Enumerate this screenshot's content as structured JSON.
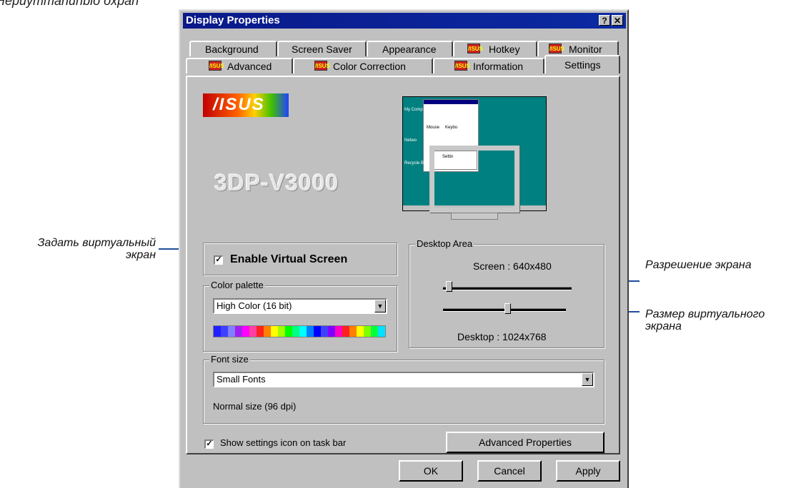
{
  "top_cutoff_text": "Hepuymmanuhbio oxpan",
  "callouts": {
    "virtual_screen": "Задать виртуальный экран",
    "resolution": "Разрешение экрана",
    "virtual_size": "Размер виртуального экрана"
  },
  "window": {
    "title": "Display Properties",
    "help_btn": "?",
    "close_btn": "✕"
  },
  "tabs_row1": [
    "Background",
    "Screen Saver",
    "Appearance",
    "Hotkey",
    "Monitor"
  ],
  "tabs_row2": [
    "Advanced",
    "Color Correction",
    "Information",
    "Settings"
  ],
  "active_tab": "Settings",
  "logo": {
    "brand": "/ISUS",
    "model": "3DP-V3000"
  },
  "preview": {
    "icons": [
      "My Comp",
      "Netwo",
      "Recycle Bin",
      "Mouse",
      "Keybo"
    ],
    "dialog_text": "Settin"
  },
  "virtual_screen": {
    "label": "Enable Virtual Screen",
    "checked": "✓"
  },
  "color_palette": {
    "label": "Color palette",
    "selected": "High Color (16 bit)",
    "bar_colors": [
      "#2020ff",
      "#4040ff",
      "#8080ff",
      "#a020f0",
      "#ff00ff",
      "#ff40a0",
      "#ff2020",
      "#ff8000",
      "#ffff00",
      "#a0ff00",
      "#00ff00",
      "#00ff80",
      "#00ffff",
      "#0080ff",
      "#0000ff",
      "#4040ff",
      "#8000ff",
      "#ff00c0",
      "#ff2020",
      "#ff8000",
      "#ffff00",
      "#80ff00",
      "#00ff40",
      "#00e0ff"
    ]
  },
  "desktop_area": {
    "label": "Desktop Area",
    "screen_text": "Screen : 640x480",
    "desktop_text": "Desktop : 1024x768",
    "screen_level": 0.0,
    "desktop_level": 0.5
  },
  "font_size": {
    "label": "Font size",
    "selected": "Small Fonts",
    "note": "Normal size (96 dpi)"
  },
  "show_icon": {
    "label": "Show settings icon on task bar",
    "checked": "✓"
  },
  "advanced_button": "Advanced Properties",
  "buttons": {
    "ok": "OK",
    "cancel": "Cancel",
    "apply": "Apply"
  },
  "colors": {
    "title_bar": "#0a1a8a",
    "desktop_teal": "#008080",
    "callout_line": "#1f4e9a"
  }
}
